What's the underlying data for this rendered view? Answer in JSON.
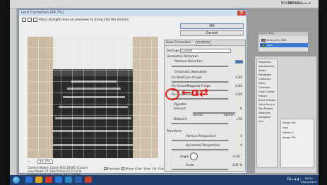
{
  "topbar": {
    "app_name": "ESSENTIALS",
    "items": "3D  ▾  ⊕  ━━━ ▾"
  },
  "camera_raw": {
    "window_title": "Lens Correction (94.7%)",
    "toolbar_hint": "Place straight lines on previews to bring into the horizon",
    "ok_label": "OK",
    "cancel_label": "Cancel",
    "tabs": [
      "Auto Correction",
      "Custom"
    ],
    "settings_label": "Settings:",
    "settings_value": "Custom",
    "geometric_distortion": "Geometric Distortion",
    "remove_distortion_label": "Remove Distortion",
    "chromatic_aberration": "Chromatic Aberration",
    "fix_red_cyan": "Fix Red/Cyan Fringe",
    "fix_green_magenta": "Fix Green/Magenta Fringe",
    "fix_blue_yellow": "Fix Blue/Yellow Fringe",
    "vignette_label": "Vignette",
    "amount_label": "Amount",
    "darken_label": "darken",
    "lighten_label": "lighten",
    "midpoint_label": "Midpoint",
    "transform_label": "Transform",
    "vertical_perspective": "Vertical Perspective",
    "horizontal_perspective": "Horizontal Perspective",
    "angle_label": "Angle",
    "scale_label": "Scale",
    "values": {
      "remove_distortion": "0.00",
      "red_cyan": "0.00",
      "green_magenta": "0.00",
      "blue_yellow": "0.00",
      "amount": "0",
      "midpoint": "+50",
      "vertical": "0",
      "horizontal": "0",
      "angle": "0.00 °",
      "scale": "100 %"
    },
    "zoom_minus": "−",
    "zoom_level": "32.2%",
    "camera_info": [
      "Camera Model: Canon EOS 1000D (Canon)",
      "Lens Model: EF-S18-55mm f/3.5-5.6 III",
      "Camera Settings: 18mm, f/11, 1/100s"
    ],
    "bottom_controls": {
      "preview": "Preview",
      "show_grid": "Show Grid",
      "size_label": "Size:",
      "size_value": "16",
      "color_label": "Color:"
    }
  },
  "annotation": {
    "symbol": "←ɑ⇄"
  },
  "ps_float": {
    "head": "Layers Pano",
    "rows": [
      "Auto_Lens_HDR",
      "Lens"
    ]
  },
  "ps_panel": {
    "list": [
      "Properties",
      "Adjustments",
      "Styles",
      "Paragraph",
      "Character",
      "Paths",
      "Channels",
      "Layer Comps",
      "History",
      "Brush Presets",
      "Clone Source",
      "Tool Presets",
      "Swatches",
      "Navigator",
      "Info"
    ],
    "layers": [
      "Image 334",
      "Lens",
      "Pattern 1",
      "Image 334"
    ]
  },
  "taskbar": {
    "tray_text": "EN ▴ ◈ ▮ ♪",
    "clock_time": "09:53",
    "clock_date": "05/02/2013"
  }
}
